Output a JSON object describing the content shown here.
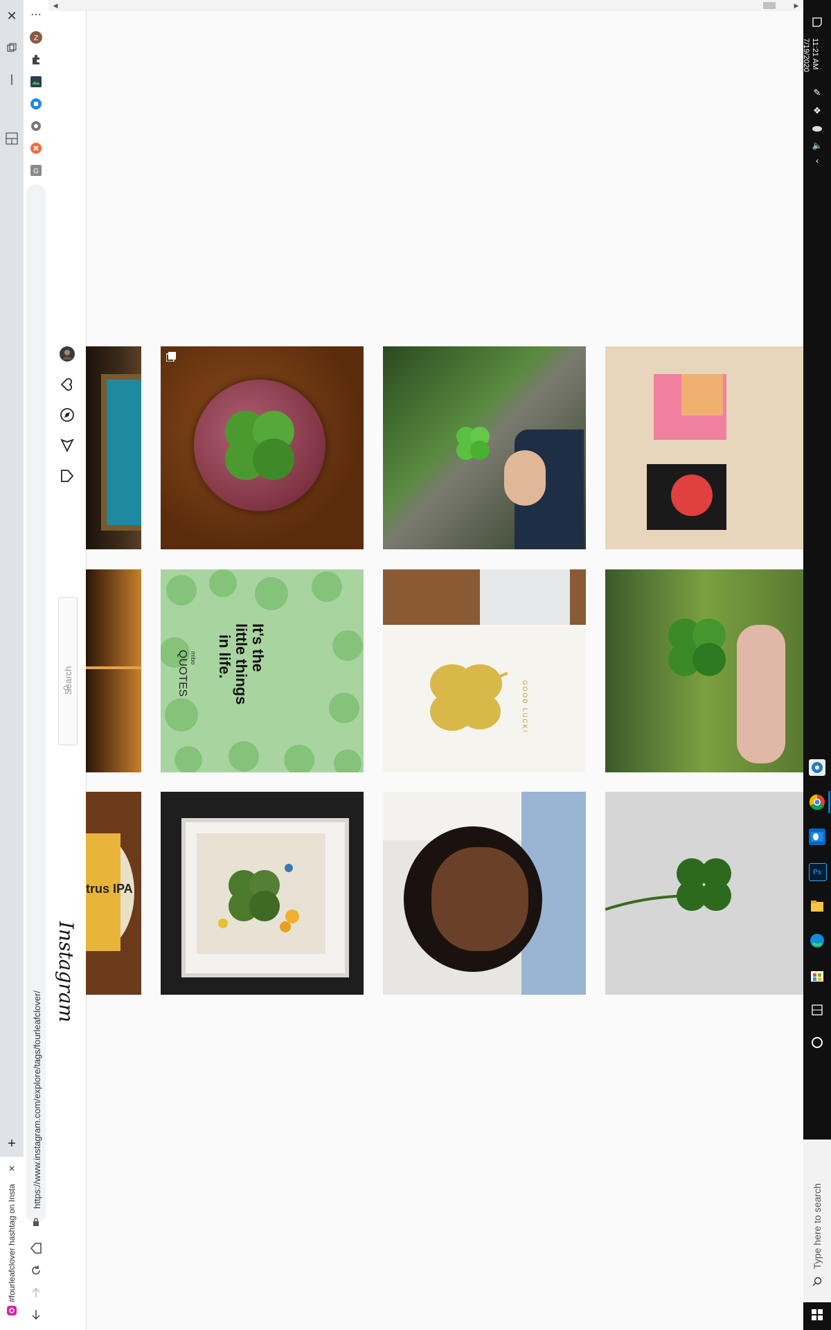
{
  "browser": {
    "tab_title": "#fourleafclover hashtag on Insta",
    "url": "https://www.instagram.com/explore/tags/fourleafclover/",
    "new_tab_label": "+",
    "tab_close_label": "×"
  },
  "instagram": {
    "logo": "Instagram",
    "search_placeholder": "Search"
  },
  "grid": {
    "tiles": [
      {
        "alt": "Paperweight with four leaf clover",
        "col": 1,
        "row": 1,
        "multi": true
      },
      {
        "alt": "Four leaf clover held over path",
        "col": 2,
        "row": 1,
        "multi": false
      },
      {
        "alt": "Puzzle cube and box",
        "col": 3,
        "row": 1,
        "multi": false
      },
      {
        "alt": "It's the little things in life quote",
        "col": 1,
        "row": 2,
        "multi": false
      },
      {
        "alt": "Good luck card with gold clover",
        "col": 2,
        "row": 2,
        "multi": false
      },
      {
        "alt": "Fingers holding clover",
        "col": 3,
        "row": 2,
        "multi": false
      },
      {
        "alt": "Framed pressed flowers and clover",
        "col": 1,
        "row": 3,
        "multi": false
      },
      {
        "alt": "Portrait selfie",
        "col": 2,
        "row": 3,
        "multi": false
      },
      {
        "alt": "Clover on white textured surface",
        "col": 3,
        "row": 3,
        "multi": false
      }
    ],
    "quote_text_lines": [
      "It's the",
      "little things",
      "in life."
    ],
    "quote_brand_small": "mibo",
    "quote_brand": "QUOTES",
    "card_text": "GOOD LUCK!",
    "beer_text": "trus IPA"
  },
  "taskbar": {
    "time": "11:21 AM",
    "date": "7/19/2020",
    "search_placeholder": "Type here to search"
  },
  "colors": {
    "ig_border": "#dbdbdb",
    "taskbar": "#101010",
    "accent_edge": "#0078d4"
  }
}
